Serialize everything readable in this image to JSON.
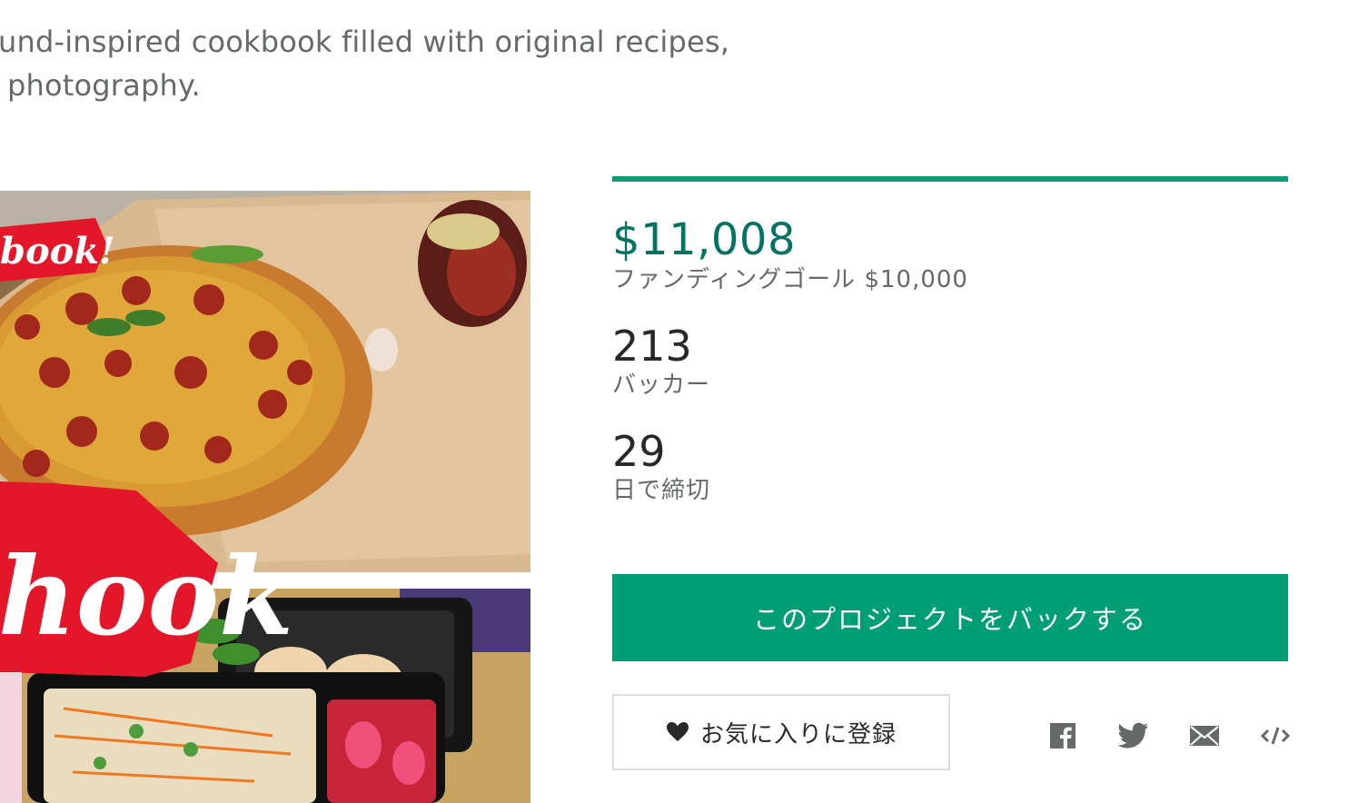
{
  "description": {
    "line1": "und-inspired cookbook filled with original recipes,",
    "line2": "photography."
  },
  "media": {
    "overlay_text_top": "book!",
    "overlay_text_bottom": "hook"
  },
  "funding": {
    "progress_fraction": 1.0,
    "pledged": "$11,008",
    "goal_label": "ファンディングゴール $10,000",
    "backers_count": "213",
    "backers_label": "バッカー",
    "days_left": "29",
    "days_label": "日で締切"
  },
  "actions": {
    "back_label": "このプロジェクトをバックする",
    "remind_label": "お気に入りに登録"
  },
  "share": {
    "icons": [
      "facebook-icon",
      "twitter-icon",
      "email-icon",
      "embed-icon"
    ]
  },
  "colors": {
    "accent": "#009e74",
    "pledged_text": "#037362",
    "muted_text": "#656969",
    "dark_text": "#282828"
  }
}
